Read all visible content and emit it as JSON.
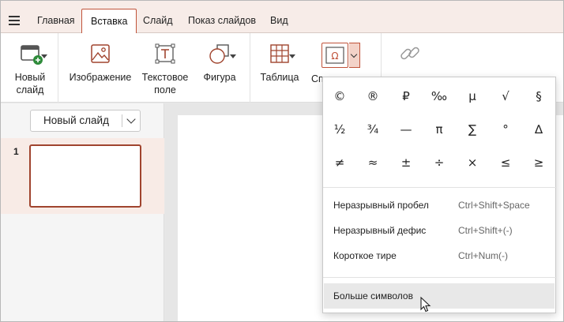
{
  "tabs": [
    {
      "label": "Главная",
      "active": false
    },
    {
      "label": "Вставка",
      "active": true
    },
    {
      "label": "Слайд",
      "active": false
    },
    {
      "label": "Показ слайдов",
      "active": false
    },
    {
      "label": "Вид",
      "active": false
    }
  ],
  "ribbon": {
    "new_slide_line1": "Новый",
    "new_slide_line2": "слайд",
    "image": "Изображение",
    "textbox_line1": "Текстовое",
    "textbox_line2": "поле",
    "shape": "Фигура",
    "table": "Таблица",
    "special_truncated": "Сп"
  },
  "left_panel": {
    "new_slide_button": "Новый слайд",
    "slide_number": "1"
  },
  "symbols": {
    "row1": [
      "©",
      "®",
      "₽",
      "‰",
      "µ",
      "√",
      "§"
    ],
    "row2": [
      "½",
      "¾",
      "—",
      "π",
      "∑",
      "°",
      "∆"
    ],
    "row3": [
      "≠",
      "≈",
      "±",
      "÷",
      "×",
      "≤",
      "≥"
    ]
  },
  "special_items": [
    {
      "label": "Неразрывный пробел",
      "shortcut": "Ctrl+Shift+Space"
    },
    {
      "label": "Неразрывный дефис",
      "shortcut": "Ctrl+Shift+(-)"
    },
    {
      "label": "Короткое тире",
      "shortcut": "Ctrl+Num(-)"
    }
  ],
  "more_symbols": "Больше символов",
  "colors": {
    "accent": "#c0533a",
    "tabbar_bg": "#f7ece8",
    "selected_slide_bg": "#f8ebe6"
  }
}
